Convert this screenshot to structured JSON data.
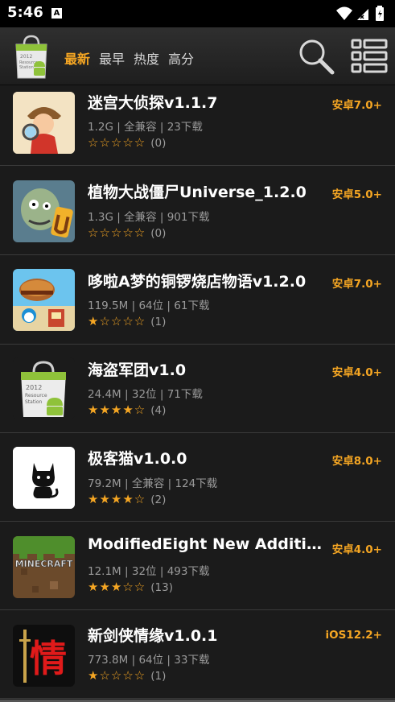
{
  "status_bar": {
    "time": "5:46",
    "notification_icon": "A"
  },
  "header": {
    "logo": {
      "year": "2012",
      "line1": "Resource",
      "line2": "Station"
    },
    "tabs": [
      {
        "label": "最新",
        "active": true
      },
      {
        "label": "最早",
        "active": false
      },
      {
        "label": "热度",
        "active": false
      },
      {
        "label": "高分",
        "active": false
      }
    ],
    "search_icon": "search-icon",
    "menu_icon": "list-menu-icon"
  },
  "apps": [
    {
      "title": "迷宫大侦探v1.1.7",
      "size": "1.2G",
      "arch": "全兼容",
      "downloads": "23下载",
      "stars": "☆☆☆☆☆",
      "rating_count": "(0)",
      "requirement": "安卓7.0+",
      "icon": "detective-icon"
    },
    {
      "title": "植物大战僵尸Universe_1.2.0",
      "size": "1.3G",
      "arch": "全兼容",
      "downloads": "901下载",
      "stars": "☆☆☆☆☆",
      "rating_count": "(0)",
      "requirement": "安卓5.0+",
      "icon": "zombie-icon"
    },
    {
      "title": "哆啦A梦的铜锣烧店物语v1.2.0",
      "size": "119.5M",
      "arch": "64位",
      "downloads": "61下载",
      "stars": "★☆☆☆☆",
      "rating_count": "(1)",
      "requirement": "安卓7.0+",
      "icon": "doraemon-icon"
    },
    {
      "title": "海盗军团v1.0",
      "size": "24.4M",
      "arch": "32位",
      "downloads": "71下载",
      "stars": "★★★★☆",
      "rating_count": "(4)",
      "requirement": "安卓4.0+",
      "icon": "android-bag-icon"
    },
    {
      "title": "极客猫v1.0.0",
      "size": "79.2M",
      "arch": "全兼容",
      "downloads": "124下载",
      "stars": "★★★★☆",
      "rating_count": "(2)",
      "requirement": "安卓8.0+",
      "icon": "cat-icon"
    },
    {
      "title": "ModifiedEight New Addition",
      "size": "12.1M",
      "arch": "32位",
      "downloads": "493下载",
      "stars": "★★★☆☆",
      "rating_count": "(13)",
      "requirement": "安卓4.0+",
      "icon": "minecraft-icon",
      "icon_text": "MINECRAFT"
    },
    {
      "title": "新剑侠情缘v1.0.1",
      "size": "773.8M",
      "arch": "64位",
      "downloads": "33下载",
      "stars": "★☆☆☆☆",
      "rating_count": "(1)",
      "requirement": "iOS12.2+",
      "icon": "sword-qing-icon",
      "icon_text": "情"
    }
  ]
}
